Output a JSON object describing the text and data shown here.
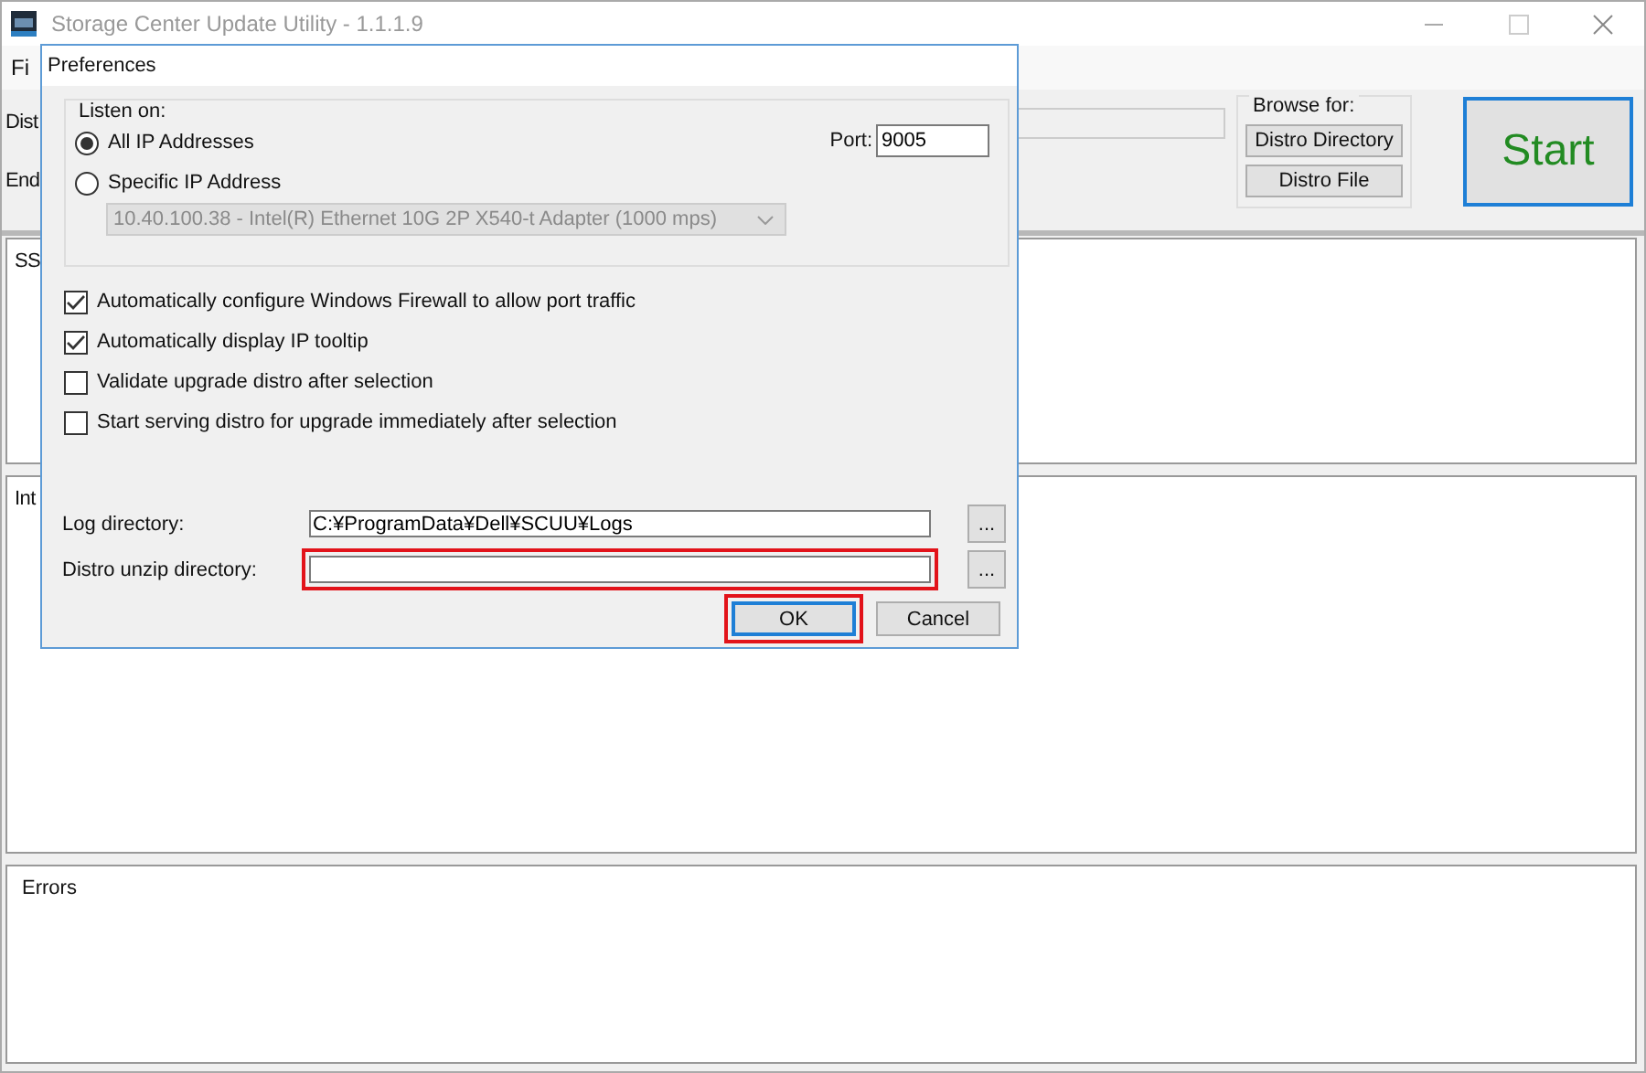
{
  "window": {
    "title": "Storage Center Update Utility - 1.1.1.9"
  },
  "menu": [
    {
      "label": "Fi"
    }
  ],
  "fields": [
    {
      "label": "Dist",
      "kind": "field"
    },
    {
      "label": "End",
      "kind": "label"
    }
  ],
  "browse_group": {
    "title": "Browse for:",
    "buttons": [
      "Distro Directory",
      "Distro File"
    ]
  },
  "start_button": "Start",
  "panels": [
    {
      "title": "SS"
    },
    {
      "title": "Int"
    },
    {
      "title": "Errors"
    }
  ],
  "dialog": {
    "title": "Preferences",
    "listen_group": {
      "title": "Listen on:",
      "options": [
        {
          "label": "All IP Addresses",
          "selected": true
        },
        {
          "label": "Specific IP Address",
          "selected": false
        }
      ],
      "adapter": {
        "value": "10.40.100.38 - Intel(R) Ethernet 10G 2P X540-t Adapter (1000 mps)",
        "disabled": true
      },
      "port": {
        "label": "Port:",
        "value": "9005"
      }
    },
    "checkboxes": [
      {
        "label": "Automatically configure Windows Firewall to allow port traffic",
        "checked": true
      },
      {
        "label": "Automatically display IP tooltip",
        "checked": true
      },
      {
        "label": "Validate upgrade distro after selection",
        "checked": false
      },
      {
        "label": "Start serving distro for upgrade immediately after selection",
        "checked": false
      }
    ],
    "paths": [
      {
        "label": "Log directory:",
        "value": "C:¥ProgramData¥Dell¥SCUU¥Logs",
        "browse": "...",
        "highlighted": false
      },
      {
        "label": "Distro unzip directory:",
        "browse": "...",
        "highlighted": true
      }
    ],
    "buttons": [
      {
        "label": "OK",
        "default": true,
        "highlighted": true
      },
      {
        "label": "Cancel",
        "default": false,
        "highlighted": false
      }
    ]
  }
}
